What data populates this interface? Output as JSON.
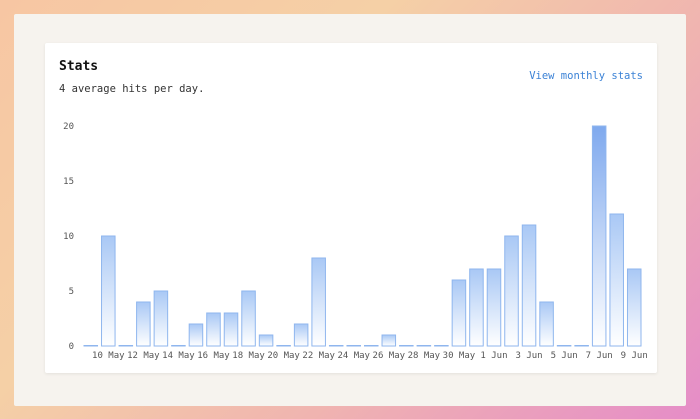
{
  "header": {
    "title": "Stats",
    "subtitle": "4 average hits per day.",
    "link_label": "View monthly stats"
  },
  "colors": {
    "bar_stroke": "#8fb6ee",
    "bar_fill_top": "#a9c8f5",
    "bar_fill_bottom": "#ffffff",
    "highlight_top": "#7fa9ee",
    "link": "#3b82d6"
  },
  "chart_data": {
    "type": "bar",
    "title": "",
    "xlabel": "",
    "ylabel": "",
    "ylim": [
      0,
      20
    ],
    "yticks": [
      "0",
      "5",
      "10",
      "15",
      "20"
    ],
    "grid": false,
    "categories": [
      "9 May",
      "10 May",
      "11 May",
      "12 May",
      "13 May",
      "14 May",
      "15 May",
      "16 May",
      "17 May",
      "18 May",
      "19 May",
      "20 May",
      "21 May",
      "22 May",
      "23 May",
      "24 May",
      "25 May",
      "26 May",
      "27 May",
      "28 May",
      "29 May",
      "30 May",
      "31 May",
      "1 Jun",
      "2 Jun",
      "3 Jun",
      "4 Jun",
      "5 Jun",
      "6 Jun",
      "7 Jun",
      "8 Jun",
      "9 Jun"
    ],
    "values": [
      0,
      10,
      0,
      4,
      5,
      0,
      2,
      3,
      3,
      5,
      1,
      0,
      2,
      8,
      0,
      0,
      0,
      1,
      0,
      0,
      0,
      6,
      7,
      7,
      10,
      11,
      4,
      0,
      0,
      20,
      12,
      7
    ],
    "xtick_labels": [
      "10 May",
      "12 May",
      "14 May",
      "16 May",
      "18 May",
      "20 May",
      "22 May",
      "24 May",
      "26 May",
      "28 May",
      "30 May",
      "1 Jun",
      "3 Jun",
      "5 Jun",
      "7 Jun",
      "9 Jun"
    ]
  }
}
